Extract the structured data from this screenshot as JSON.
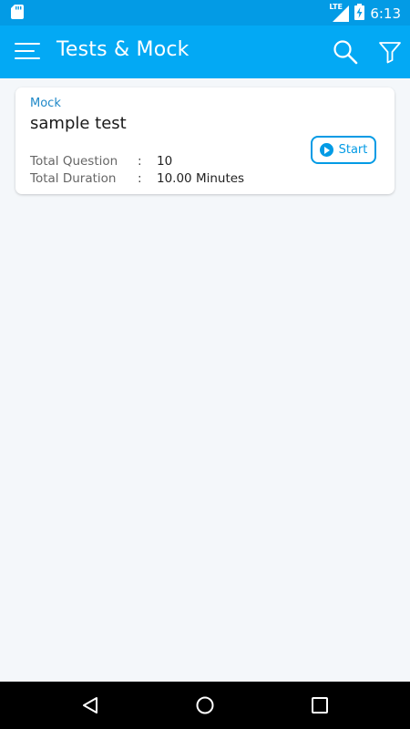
{
  "status_bar": {
    "time": "6:13",
    "network": "LTE",
    "icons": [
      "sd-card-icon",
      "lte-signal-icon",
      "battery-charging-icon"
    ]
  },
  "app_bar": {
    "title": "Tests & Mock",
    "icons": [
      "menu-icon",
      "search-icon",
      "filter-icon"
    ],
    "color": "#03a9f4"
  },
  "test_card": {
    "type": "Mock",
    "title": "sample test",
    "rows": [
      {
        "label": "Total Question",
        "colon": ":",
        "value": "10"
      },
      {
        "label": "Total Duration",
        "colon": ":",
        "value": "10.00 Minutes"
      }
    ],
    "start_label": "Start",
    "accent": "#039be5"
  },
  "nav_bar": {
    "icons": [
      "back-icon",
      "home-icon",
      "recent-apps-icon"
    ]
  }
}
